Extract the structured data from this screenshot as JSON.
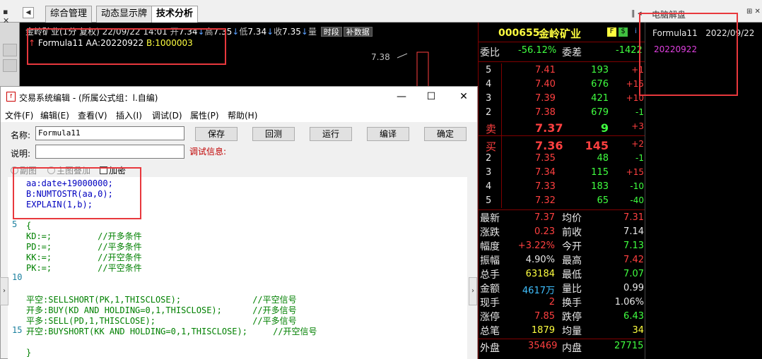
{
  "tabbar": {
    "tabs": [
      "综合管理",
      "动态显示牌",
      "技术分析"
    ],
    "active_tab": 2,
    "right_title": "电脑解盘"
  },
  "chart": {
    "header": {
      "title": "金岭矿业(1分 复权) 22/09/22 14:01",
      "open_label": "开",
      "open": "7.34",
      "high_label": "高",
      "high": "7.35",
      "low_label": "低",
      "low": "7.34",
      "close_label": "收",
      "close": "7.35",
      "vol_label": "量",
      "chip1": "时段",
      "chip2": "补数据"
    },
    "formula_line": {
      "name": "Formula11",
      "aa": "AA:20220922",
      "b": "B:1000003"
    },
    "price_label": "7.38"
  },
  "quote": {
    "code": "000655",
    "name": "金岭矿业",
    "weibi_label": "委比",
    "weibi": "-56.12%",
    "weicha_label": "委差",
    "weicha": "-1422",
    "sell": [
      {
        "level": "5",
        "price": "7.41",
        "vol": "193",
        "chg": "+1"
      },
      {
        "level": "4",
        "price": "7.40",
        "vol": "676",
        "chg": "+15"
      },
      {
        "level": "3",
        "price": "7.39",
        "vol": "421",
        "chg": "+10"
      },
      {
        "level": "2",
        "price": "7.38",
        "vol": "679",
        "chg": "-1"
      },
      {
        "level": "卖",
        "price": "7.37",
        "vol": "9",
        "chg": "+3"
      }
    ],
    "buy": [
      {
        "level": "买",
        "price": "7.36",
        "vol": "145",
        "chg": "+2"
      },
      {
        "level": "2",
        "price": "7.35",
        "vol": "48",
        "chg": "-1"
      },
      {
        "level": "3",
        "price": "7.34",
        "vol": "115",
        "chg": "+15"
      },
      {
        "level": "4",
        "price": "7.33",
        "vol": "183",
        "chg": "-10"
      },
      {
        "level": "5",
        "price": "7.32",
        "vol": "65",
        "chg": "-40"
      }
    ],
    "stats": [
      {
        "l1": "最新",
        "v1": "7.37",
        "c1": "#ff4040",
        "l2": "均价",
        "v2": "7.31",
        "c2": "#ff4040"
      },
      {
        "l1": "涨跌",
        "v1": "0.23",
        "c1": "#ff4040",
        "l2": "前收",
        "v2": "7.14",
        "c2": "#e8e8e8"
      },
      {
        "l1": "幅度",
        "v1": "+3.22%",
        "c1": "#ff4040",
        "l2": "今开",
        "v2": "7.13",
        "c2": "#40ff40"
      },
      {
        "l1": "振幅",
        "v1": "4.90%",
        "c1": "#e8e8e8",
        "l2": "最高",
        "v2": "7.42",
        "c2": "#ff4040"
      },
      {
        "l1": "总手",
        "v1": "63184",
        "c1": "#ffff40",
        "l2": "最低",
        "v2": "7.07",
        "c2": "#40ff40"
      },
      {
        "l1": "金额",
        "v1": "4617万",
        "c1": "#40c0ff",
        "l2": "量比",
        "v2": "0.99",
        "c2": "#e8e8e8"
      },
      {
        "l1": "现手",
        "v1": "2",
        "c1": "#ff4040",
        "l2": "换手",
        "v2": "1.06%",
        "c2": "#e8e8e8"
      },
      {
        "l1": "涨停",
        "v1": "7.85",
        "c1": "#ff4040",
        "l2": "跌停",
        "v2": "6.43",
        "c2": "#40ff40"
      },
      {
        "l1": "总笔",
        "v1": "1879",
        "c1": "#ffff40",
        "l2": "均量",
        "v2": "34",
        "c2": "#ffff40"
      }
    ],
    "waipan_label": "外盘",
    "waipan": "35469",
    "neipan_label": "内盘",
    "neipan": "27715"
  },
  "rightpanel": {
    "formula": "Formula11",
    "date": "2022/09/22",
    "value": "20220922"
  },
  "editor": {
    "title": "交易系统编辑 - (所属公式组：l.自编)",
    "menu": [
      "文件(F)",
      "编辑(E)",
      "查看(V)",
      "插入(I)",
      "调试(D)",
      "属性(P)",
      "帮助(H)"
    ],
    "name_label": "名称:",
    "name_value": "Formula11",
    "desc_label": "说明:",
    "desc_value": "",
    "debug_label": "调试信息:",
    "buttons": [
      "保存",
      "回测",
      "运行",
      "编译",
      "确定"
    ],
    "options": [
      "副图",
      "主图叠加",
      "加密"
    ],
    "line_numbers": [
      "5",
      "10",
      "15"
    ],
    "code": [
      {
        "text": "aa:date+19000000;",
        "color": "blue"
      },
      {
        "text": "B:NUMTOSTR(aa,0);",
        "color": "blue"
      },
      {
        "text": "EXPLAIN(1,b);",
        "color": "blue"
      },
      {
        "text": "",
        "color": "blue"
      },
      {
        "text": "{",
        "color": "green"
      },
      {
        "text": "KD:=;         //开多条件",
        "color": "green"
      },
      {
        "text": "PD:=;         //平多条件",
        "color": "green"
      },
      {
        "text": "KK:=;         //开空条件",
        "color": "green"
      },
      {
        "text": "PK:=;         //平空条件",
        "color": "green"
      },
      {
        "text": "",
        "color": "green"
      },
      {
        "text": "",
        "color": "green"
      },
      {
        "text": "平空:SELLSHORT(PK,1,THISCLOSE);              //平空信号",
        "color": "green"
      },
      {
        "text": "开多:BUY(KD AND HOLDING=0,1,THISCLOSE);      //开多信号",
        "color": "green"
      },
      {
        "text": "平多:SELL(PD,1,THISCLOSE);                   //平多信号",
        "color": "green"
      },
      {
        "text": "开空:BUYSHORT(KK AND HOLDING=0,1,THISCLOSE);     //开空信号",
        "color": "green"
      },
      {
        "text": "",
        "color": "green"
      },
      {
        "text": "}",
        "color": "green"
      }
    ]
  },
  "colors": {
    "accent_red": "#e8383d",
    "up": "#ff4040",
    "down": "#40ff40",
    "highlight": "#ffff40"
  }
}
